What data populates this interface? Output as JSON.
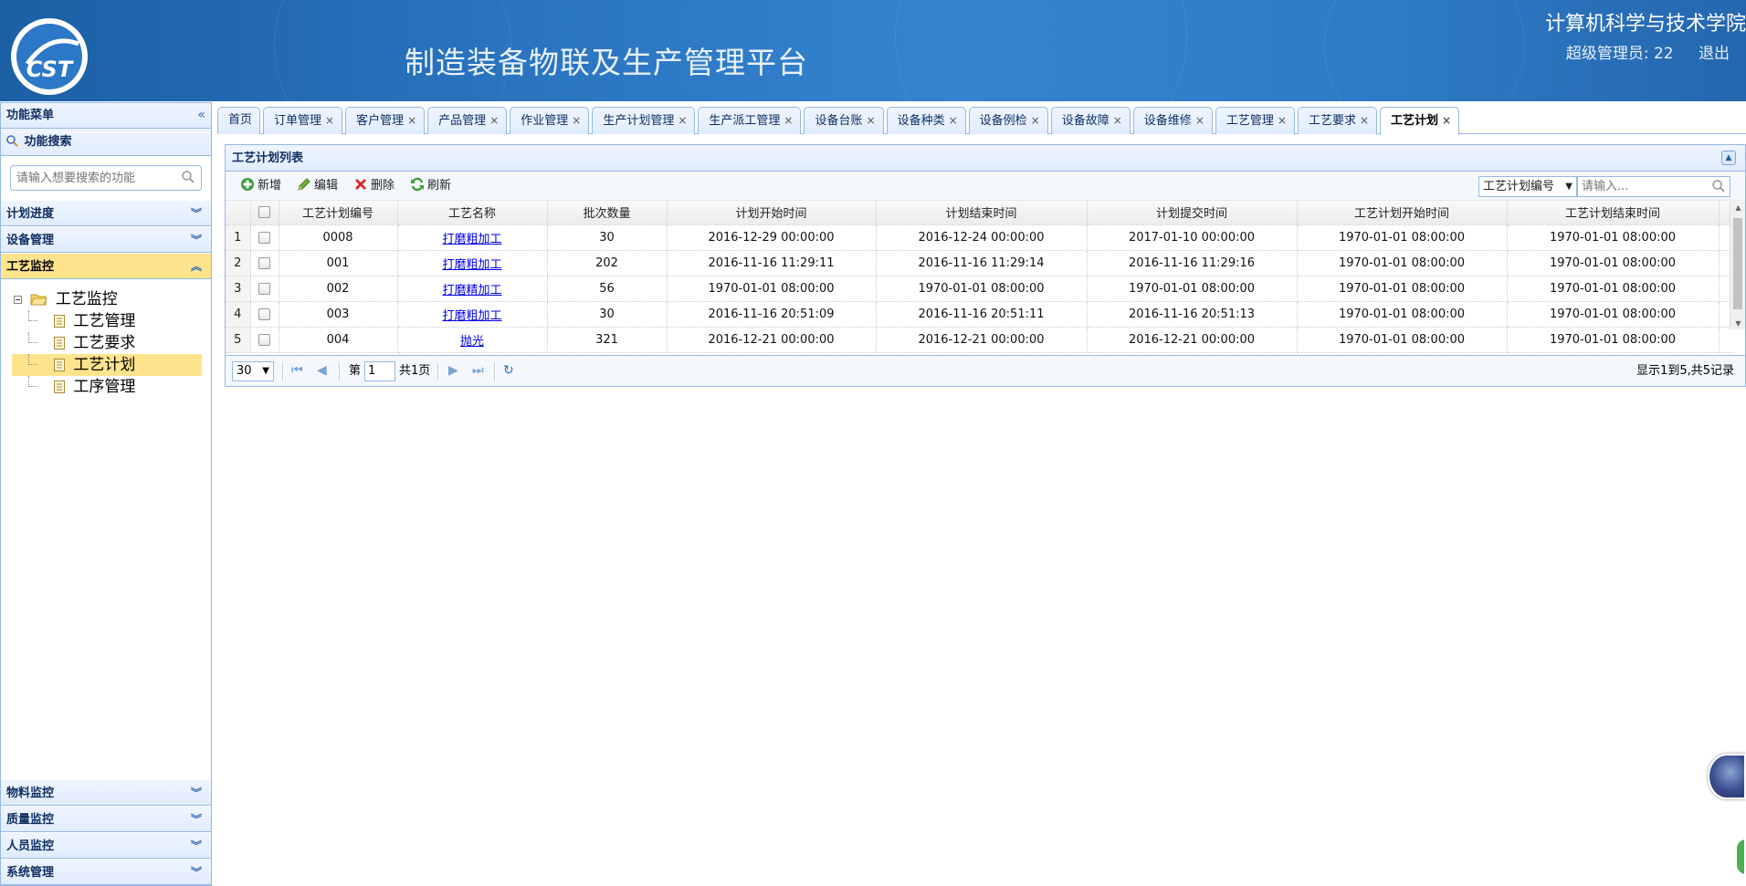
{
  "header": {
    "app_title": "制造装备物联及生产管理平台",
    "org_name": "计算机科学与技术学院",
    "user_label": "超级管理员: 22",
    "logout": "退出",
    "logo_text": "CST"
  },
  "sidebar": {
    "title": "功能菜单",
    "collapse_glyph": "«",
    "search_title": "功能搜索",
    "search_placeholder": "请输入想要搜索的功能",
    "accordions_top": [
      "计划进度",
      "设备管理",
      "工艺监控"
    ],
    "tree": {
      "root": "工艺监控",
      "children": [
        "工艺管理",
        "工艺要求",
        "工艺计划",
        "工序管理"
      ],
      "selected_index": 2
    },
    "accordions_bottom": [
      "物料监控",
      "质量监控",
      "人员监控",
      "系统管理"
    ]
  },
  "tabs": [
    {
      "label": "首页",
      "closable": false
    },
    {
      "label": "订单管理",
      "closable": true
    },
    {
      "label": "客户管理",
      "closable": true
    },
    {
      "label": "产品管理",
      "closable": true
    },
    {
      "label": "作业管理",
      "closable": true
    },
    {
      "label": "生产计划管理",
      "closable": true
    },
    {
      "label": "生产派工管理",
      "closable": true
    },
    {
      "label": "设备台账",
      "closable": true
    },
    {
      "label": "设备种类",
      "closable": true
    },
    {
      "label": "设备例检",
      "closable": true
    },
    {
      "label": "设备故障",
      "closable": true
    },
    {
      "label": "设备维修",
      "closable": true
    },
    {
      "label": "工艺管理",
      "closable": true
    },
    {
      "label": "工艺要求",
      "closable": true
    },
    {
      "label": "工艺计划",
      "closable": true,
      "active": true
    }
  ],
  "grid": {
    "title": "工艺计划列表",
    "toolbar": {
      "add": "新增",
      "edit": "编辑",
      "delete": "删除",
      "refresh": "刷新"
    },
    "search": {
      "field": "工艺计划编号",
      "placeholder": "请输入..."
    },
    "columns": [
      "工艺计划编号",
      "工艺名称",
      "批次数量",
      "计划开始时间",
      "计划结束时间",
      "计划提交时间",
      "工艺计划开始时间",
      "工艺计划结束时间"
    ],
    "rows": [
      {
        "n": "1",
        "id": "0008",
        "name": "打磨粗加工",
        "qty": "30",
        "plan_start": "2016-12-29 00:00:00",
        "plan_end": "2016-12-24 00:00:00",
        "submit": "2017-01-10 00:00:00",
        "proc_start": "1970-01-01 08:00:00",
        "proc_end": "1970-01-01 08:00:00"
      },
      {
        "n": "2",
        "id": "001",
        "name": "打磨粗加工",
        "qty": "202",
        "plan_start": "2016-11-16 11:29:11",
        "plan_end": "2016-11-16 11:29:14",
        "submit": "2016-11-16 11:29:16",
        "proc_start": "1970-01-01 08:00:00",
        "proc_end": "1970-01-01 08:00:00"
      },
      {
        "n": "3",
        "id": "002",
        "name": "打磨精加工",
        "qty": "56",
        "plan_start": "1970-01-01 08:00:00",
        "plan_end": "1970-01-01 08:00:00",
        "submit": "1970-01-01 08:00:00",
        "proc_start": "1970-01-01 08:00:00",
        "proc_end": "1970-01-01 08:00:00"
      },
      {
        "n": "4",
        "id": "003",
        "name": "打磨粗加工",
        "qty": "30",
        "plan_start": "2016-11-16 20:51:09",
        "plan_end": "2016-11-16 20:51:11",
        "submit": "2016-11-16 20:51:13",
        "proc_start": "1970-01-01 08:00:00",
        "proc_end": "1970-01-01 08:00:00"
      },
      {
        "n": "5",
        "id": "004",
        "name": "抛光",
        "qty": "321",
        "plan_start": "2016-12-21 00:00:00",
        "plan_end": "2016-12-21 00:00:00",
        "submit": "2016-12-21 00:00:00",
        "proc_start": "1970-01-01 08:00:00",
        "proc_end": "1970-01-01 08:00:00"
      }
    ],
    "pager": {
      "page_size": "30",
      "page_label": "第",
      "page_value": "1",
      "total_label": "共1页",
      "info": "显示1到5,共5记录"
    }
  },
  "colors": {
    "header_bg": "#2a74c0",
    "border": "#95b8e7",
    "selected": "#ffe48d",
    "link": "#0000ee"
  }
}
